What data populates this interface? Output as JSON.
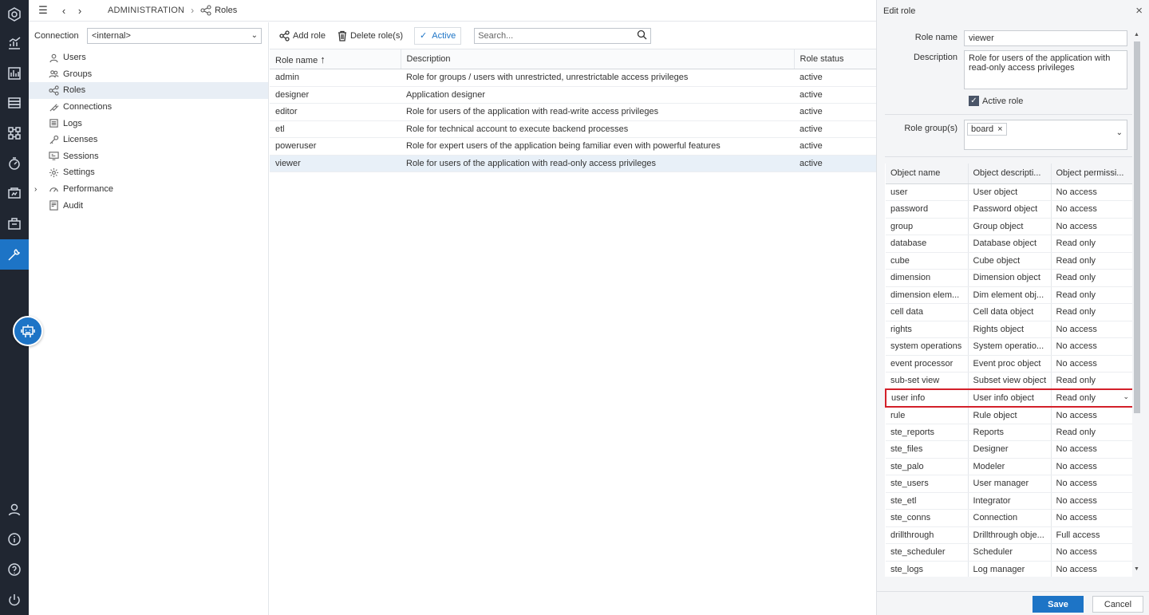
{
  "breadcrumb": {
    "section": "ADMINISTRATION",
    "page": "Roles"
  },
  "nav": {
    "connection_label": "Connection",
    "connection_value": "<internal>",
    "items": [
      {
        "label": "Users",
        "icon": "user-icon"
      },
      {
        "label": "Groups",
        "icon": "group-icon"
      },
      {
        "label": "Roles",
        "icon": "roles-icon"
      },
      {
        "label": "Connections",
        "icon": "plug-icon"
      },
      {
        "label": "Logs",
        "icon": "log-icon"
      },
      {
        "label": "Licenses",
        "icon": "key-icon"
      },
      {
        "label": "Sessions",
        "icon": "monitor-icon"
      },
      {
        "label": "Settings",
        "icon": "gear-icon"
      },
      {
        "label": "Performance",
        "icon": "gauge-icon"
      },
      {
        "label": "Audit",
        "icon": "audit-icon"
      }
    ]
  },
  "toolbar": {
    "add_label": "Add role",
    "delete_label": "Delete role(s)",
    "active_label": "Active",
    "search_placeholder": "Search..."
  },
  "roles_table": {
    "headers": [
      "Role name",
      "Description",
      "Role status"
    ],
    "rows": [
      [
        "admin",
        "Role for groups / users with unrestricted, unrestrictable access privileges",
        "active"
      ],
      [
        "designer",
        "Application designer",
        "active"
      ],
      [
        "editor",
        "Role for users of the application with read-write access privileges",
        "active"
      ],
      [
        "etl",
        "Role for technical account to execute backend processes",
        "active"
      ],
      [
        "poweruser",
        "Role for expert users of the application being familiar even with powerful features",
        "active"
      ],
      [
        "viewer",
        "Role for users of the application with read-only access privileges",
        "active"
      ]
    ]
  },
  "editor": {
    "title": "Edit role",
    "role_name_label": "Role name",
    "role_name_value": "viewer",
    "description_label": "Description",
    "description_value": "Role for users of the application with read-only access privileges",
    "active_role_label": "Active role",
    "role_groups_label": "Role group(s)",
    "role_group_tag": "board",
    "perm_headers": [
      "Object name",
      "Object descripti...",
      "Object permissi..."
    ],
    "perm_rows": [
      [
        "user",
        "User object",
        "No access"
      ],
      [
        "password",
        "Password object",
        "No access"
      ],
      [
        "group",
        "Group object",
        "No access"
      ],
      [
        "database",
        "Database object",
        "Read only"
      ],
      [
        "cube",
        "Cube object",
        "Read only"
      ],
      [
        "dimension",
        "Dimension object",
        "Read only"
      ],
      [
        "dimension elem...",
        "Dim element obj...",
        "Read only"
      ],
      [
        "cell data",
        "Cell data object",
        "Read only"
      ],
      [
        "rights",
        "Rights object",
        "No access"
      ],
      [
        "system operations",
        "System operatio...",
        "No access"
      ],
      [
        "event processor",
        "Event proc object",
        "No access"
      ],
      [
        "sub-set view",
        "Subset view object",
        "Read only"
      ],
      [
        "user info",
        "User info object",
        "Read only"
      ],
      [
        "rule",
        "Rule object",
        "No access"
      ],
      [
        "ste_reports",
        "Reports",
        "Read only"
      ],
      [
        "ste_files",
        "Designer",
        "No access"
      ],
      [
        "ste_palo",
        "Modeler",
        "No access"
      ],
      [
        "ste_users",
        "User manager",
        "No access"
      ],
      [
        "ste_etl",
        "Integrator",
        "No access"
      ],
      [
        "ste_conns",
        "Connection",
        "No access"
      ],
      [
        "drillthrough",
        "Drillthrough obje...",
        "Full access"
      ],
      [
        "ste_scheduler",
        "Scheduler",
        "No access"
      ],
      [
        "ste_logs",
        "Log manager",
        "No access"
      ]
    ],
    "save_label": "Save",
    "cancel_label": "Cancel"
  },
  "colors": {
    "accent": "#1d74c6",
    "rail": "#202631",
    "highlight": "#d3202a"
  }
}
